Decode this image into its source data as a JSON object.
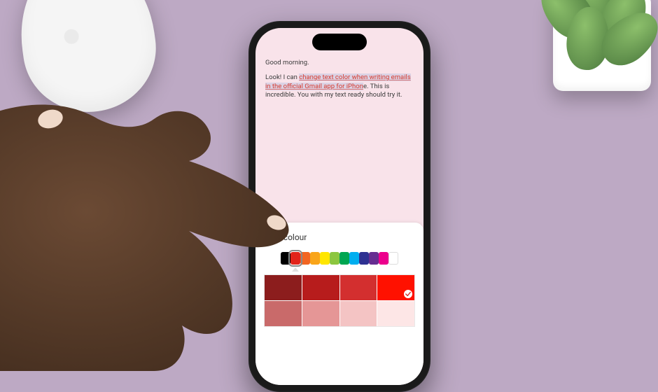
{
  "compose": {
    "greeting": "Good morning.",
    "body_prefix": "Look! I can ",
    "body_highlight": "change text color when writing emails in the official Gmail app for iPhon",
    "body_suffix": "e. This is incredible. You with my text ready should try it."
  },
  "picker": {
    "title": "Text colour",
    "hues": [
      {
        "color": "#000000",
        "selected": false
      },
      {
        "color": "#e2231a",
        "selected": true
      },
      {
        "color": "#f26522",
        "selected": false
      },
      {
        "color": "#f9a51a",
        "selected": false
      },
      {
        "color": "#ffe600",
        "selected": false
      },
      {
        "color": "#8cc63f",
        "selected": false
      },
      {
        "color": "#00a651",
        "selected": false
      },
      {
        "color": "#00aeef",
        "selected": false
      },
      {
        "color": "#2e3192",
        "selected": false
      },
      {
        "color": "#662d91",
        "selected": false
      },
      {
        "color": "#ec008c",
        "selected": false
      },
      {
        "color": "#ffffff",
        "selected": false
      }
    ],
    "shades": [
      {
        "color": "#8c1d1d",
        "selected": false
      },
      {
        "color": "#b71c1c",
        "selected": false
      },
      {
        "color": "#d32f2f",
        "selected": false
      },
      {
        "color": "#ff1100",
        "selected": true
      },
      {
        "color": "#c96a6a",
        "selected": false
      },
      {
        "color": "#e59696",
        "selected": false
      },
      {
        "color": "#f4c4c4",
        "selected": false
      },
      {
        "color": "#fde6e6",
        "selected": false
      }
    ]
  }
}
